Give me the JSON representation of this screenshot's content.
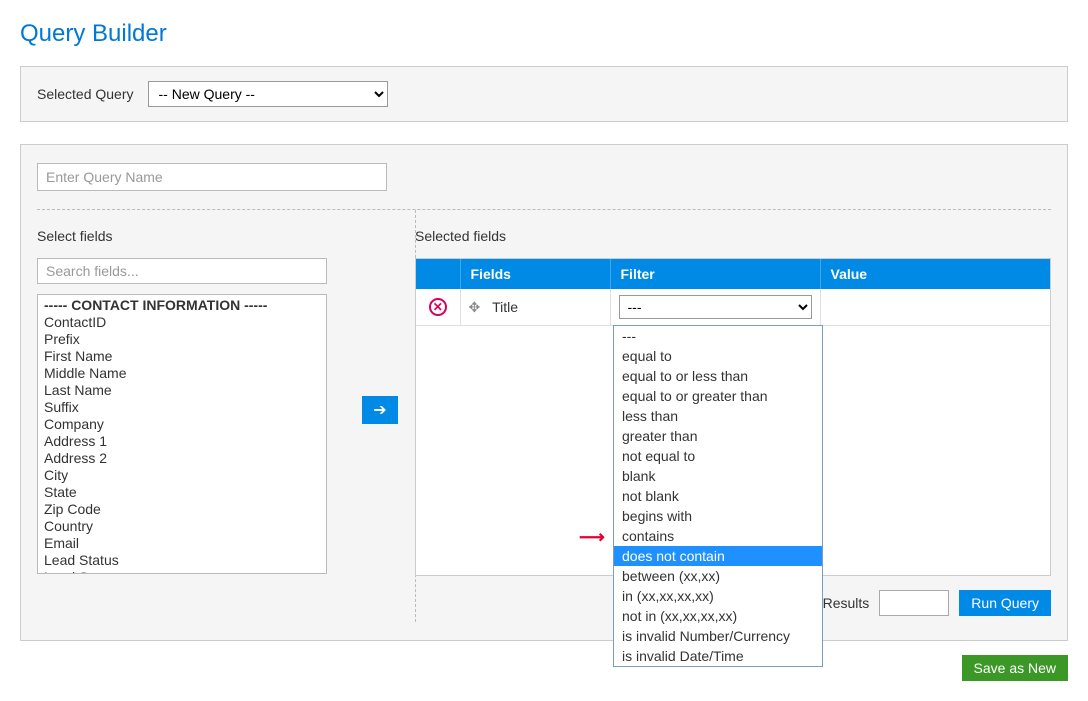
{
  "title": "Query Builder",
  "selected_query": {
    "label": "Selected Query",
    "value": "-- New Query --"
  },
  "query_name_placeholder": "Enter Query Name",
  "left": {
    "title": "Select fields",
    "search_placeholder": "Search fields...",
    "fields": [
      {
        "label": "----- CONTACT INFORMATION -----",
        "header": true
      },
      {
        "label": "ContactID"
      },
      {
        "label": "Prefix"
      },
      {
        "label": "First Name"
      },
      {
        "label": "Middle Name"
      },
      {
        "label": "Last Name"
      },
      {
        "label": "Suffix"
      },
      {
        "label": "Company"
      },
      {
        "label": "Address 1"
      },
      {
        "label": "Address 2"
      },
      {
        "label": "City"
      },
      {
        "label": "State"
      },
      {
        "label": "Zip Code"
      },
      {
        "label": "Country"
      },
      {
        "label": "Email"
      },
      {
        "label": "Lead Status"
      },
      {
        "label": "Lead Source"
      }
    ]
  },
  "right": {
    "title": "Selected fields",
    "columns": {
      "fields": "Fields",
      "filter": "Filter",
      "value": "Value"
    },
    "row": {
      "field": "Title",
      "filter_display": "---"
    },
    "filter_options": [
      "---",
      "equal to",
      "equal to or less than",
      "equal to or greater than",
      "less than",
      "greater than",
      "not equal to",
      "blank",
      "not blank",
      "begins with",
      "contains",
      "does not contain",
      "between (xx,xx)",
      "in (xx,xx,xx,xx)",
      "not in (xx,xx,xx,xx)",
      "is invalid Number/Currency",
      "is invalid Date/Time"
    ],
    "highlighted_option": "does not contain"
  },
  "footer": {
    "results_label": "Query Results",
    "run_label": "Run Query",
    "save_label": "Save as New"
  }
}
